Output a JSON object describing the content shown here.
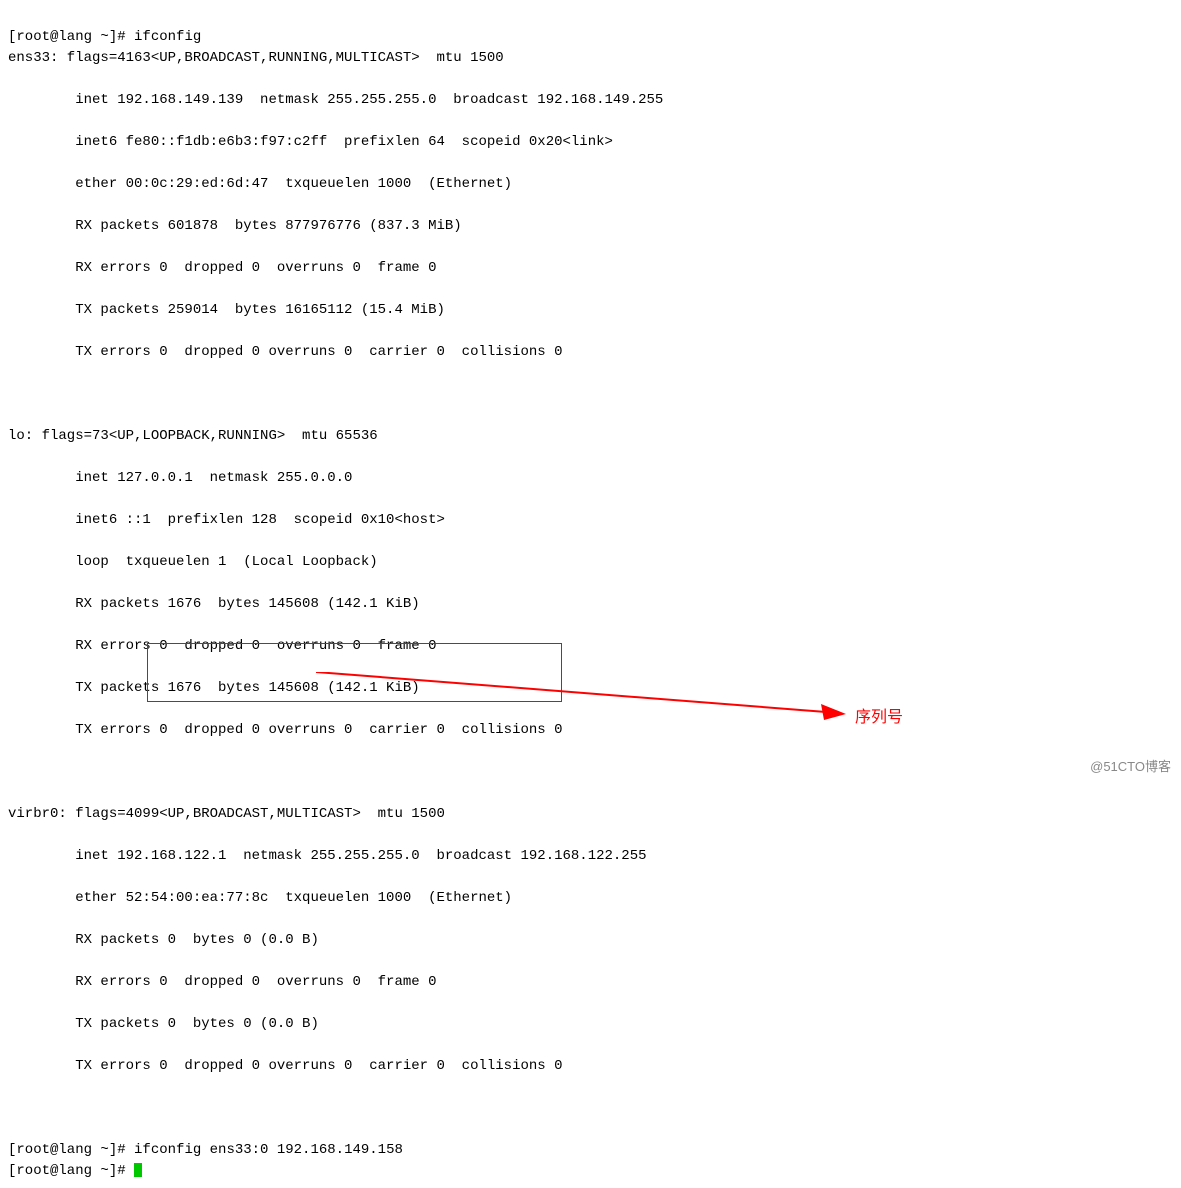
{
  "prompt1": "[root@lang ~]# ",
  "cmd1": "ifconfig",
  "ens33": {
    "l1": "ens33: flags=4163<UP,BROADCAST,RUNNING,MULTICAST>  mtu 1500",
    "l2": "        inet 192.168.149.139  netmask 255.255.255.0  broadcast 192.168.149.255",
    "l3": "        inet6 fe80::f1db:e6b3:f97:c2ff  prefixlen 64  scopeid 0x20<link>",
    "l4": "        ether 00:0c:29:ed:6d:47  txqueuelen 1000  (Ethernet)",
    "l5": "        RX packets 601878  bytes 877976776 (837.3 MiB)",
    "l6": "        RX errors 0  dropped 0  overruns 0  frame 0",
    "l7": "        TX packets 259014  bytes 16165112 (15.4 MiB)",
    "l8": "        TX errors 0  dropped 0 overruns 0  carrier 0  collisions 0"
  },
  "lo": {
    "l1": "lo: flags=73<UP,LOOPBACK,RUNNING>  mtu 65536",
    "l2": "        inet 127.0.0.1  netmask 255.0.0.0",
    "l3": "        inet6 ::1  prefixlen 128  scopeid 0x10<host>",
    "l4": "        loop  txqueuelen 1  (Local Loopback)",
    "l5": "        RX packets 1676  bytes 145608 (142.1 KiB)",
    "l6": "        RX errors 0  dropped 0  overruns 0  frame 0",
    "l7": "        TX packets 1676  bytes 145608 (142.1 KiB)",
    "l8": "        TX errors 0  dropped 0 overruns 0  carrier 0  collisions 0"
  },
  "virbr0": {
    "l1": "virbr0: flags=4099<UP,BROADCAST,MULTICAST>  mtu 1500",
    "l2": "        inet 192.168.122.1  netmask 255.255.255.0  broadcast 192.168.122.255",
    "l3": "        ether 52:54:00:ea:77:8c  txqueuelen 1000  (Ethernet)",
    "l4": "        RX packets 0  bytes 0 (0.0 B)",
    "l5": "        RX errors 0  dropped 0  overruns 0  frame 0",
    "l6": "        TX packets 0  bytes 0 (0.0 B)",
    "l7": "        TX errors 0  dropped 0 overruns 0  carrier 0  collisions 0"
  },
  "prompt2": "[root@lang ~]# ",
  "cmd2": "ifconfig ens33:0 192.168.149.158",
  "prompt3": "[root@lang ~]# ",
  "annotation": "序列号",
  "watermark": "@51CTO博客"
}
